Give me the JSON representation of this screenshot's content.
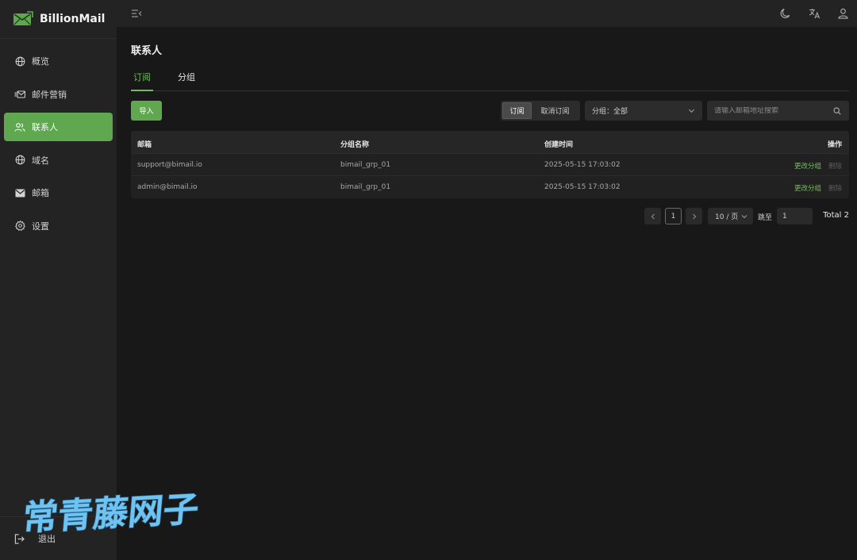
{
  "brand": {
    "name": "BillionMail",
    "accent": "#5fa84f"
  },
  "sidebar": {
    "items": [
      {
        "label": "概览",
        "icon": "globe-icon",
        "active": false
      },
      {
        "label": "邮件营销",
        "icon": "mail-send-icon",
        "active": false
      },
      {
        "label": "联系人",
        "icon": "users-icon",
        "active": true
      },
      {
        "label": "域名",
        "icon": "globe-icon",
        "active": false
      },
      {
        "label": "邮箱",
        "icon": "envelope-icon",
        "active": false
      },
      {
        "label": "设置",
        "icon": "gear-icon",
        "active": false
      }
    ],
    "logout_label": "退出"
  },
  "topbar": {
    "icons": [
      "collapse-menu-icon",
      "moon-icon",
      "translate-icon",
      "user-icon"
    ]
  },
  "page": {
    "title": "联系人",
    "tabs": [
      {
        "label": "订阅",
        "active": true
      },
      {
        "label": "分组",
        "active": false
      }
    ]
  },
  "toolbar": {
    "import_label": "导入",
    "segment": {
      "subscribed": "订阅",
      "unsubscribed": "取消订阅",
      "selected": "subscribed"
    },
    "group_select": {
      "value": "分组：全部"
    },
    "search": {
      "placeholder": "请输入邮箱地址搜索"
    }
  },
  "table": {
    "headers": {
      "email": "邮箱",
      "group": "分组名称",
      "created": "创建时间",
      "ops": "操作"
    },
    "rows": [
      {
        "email": "support@bimail.io",
        "group": "bimail_grp_01",
        "created": "2025-05-15 17:03:02",
        "change": "更改分组",
        "delete": "删除"
      },
      {
        "email": "admin@bimail.io",
        "group": "bimail_grp_01",
        "created": "2025-05-15 17:03:02",
        "change": "更改分组",
        "delete": "删除"
      }
    ]
  },
  "pagination": {
    "current_page": "1",
    "page_size": "10 / 页",
    "jump_label": "跳至",
    "jump_value": "1",
    "total": "Total 2"
  },
  "watermark": {
    "text": "常青藤网子",
    "color": "#6ec3f0"
  }
}
